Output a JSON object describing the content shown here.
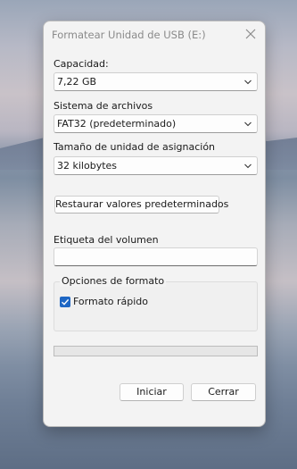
{
  "window": {
    "title": "Formatear Unidad de USB (E:)"
  },
  "capacity": {
    "label": "Capacidad:",
    "value": "7,22 GB"
  },
  "filesystem": {
    "label": "Sistema de archivos",
    "value": "FAT32 (predeterminado)"
  },
  "allocation": {
    "label": "Tamaño de unidad de asignación",
    "value": "32 kilobytes"
  },
  "restore_button": "Restaurar valores predeterminados",
  "volume": {
    "label": "Etiqueta del volumen",
    "value": ""
  },
  "format_options": {
    "title": "Opciones de formato",
    "quick_format_label": "Formato rápido",
    "quick_format_checked": true
  },
  "progress": {
    "value": 0
  },
  "buttons": {
    "start": "Iniciar",
    "close": "Cerrar"
  },
  "colors": {
    "accent": "#1f67c4",
    "dialog_bg": "#f3f3f3"
  }
}
